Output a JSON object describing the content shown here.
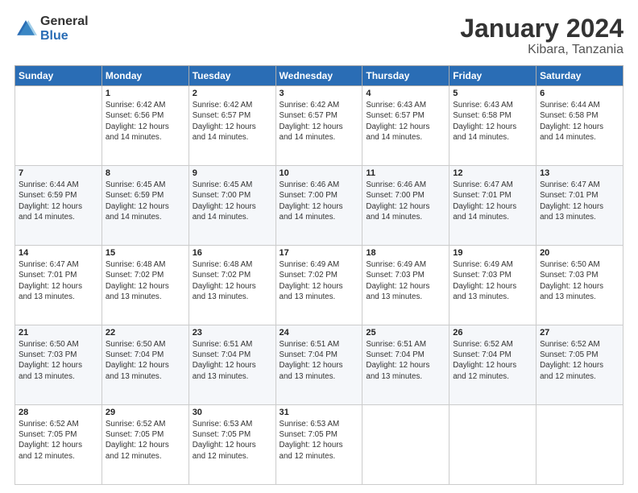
{
  "logo": {
    "general": "General",
    "blue": "Blue"
  },
  "title": {
    "month": "January 2024",
    "location": "Kibara, Tanzania"
  },
  "weekdays": [
    "Sunday",
    "Monday",
    "Tuesday",
    "Wednesday",
    "Thursday",
    "Friday",
    "Saturday"
  ],
  "weeks": [
    [
      {
        "day": "",
        "info": ""
      },
      {
        "day": "1",
        "info": "Sunrise: 6:42 AM\nSunset: 6:56 PM\nDaylight: 12 hours\nand 14 minutes."
      },
      {
        "day": "2",
        "info": "Sunrise: 6:42 AM\nSunset: 6:57 PM\nDaylight: 12 hours\nand 14 minutes."
      },
      {
        "day": "3",
        "info": "Sunrise: 6:42 AM\nSunset: 6:57 PM\nDaylight: 12 hours\nand 14 minutes."
      },
      {
        "day": "4",
        "info": "Sunrise: 6:43 AM\nSunset: 6:57 PM\nDaylight: 12 hours\nand 14 minutes."
      },
      {
        "day": "5",
        "info": "Sunrise: 6:43 AM\nSunset: 6:58 PM\nDaylight: 12 hours\nand 14 minutes."
      },
      {
        "day": "6",
        "info": "Sunrise: 6:44 AM\nSunset: 6:58 PM\nDaylight: 12 hours\nand 14 minutes."
      }
    ],
    [
      {
        "day": "7",
        "info": "Sunrise: 6:44 AM\nSunset: 6:59 PM\nDaylight: 12 hours\nand 14 minutes."
      },
      {
        "day": "8",
        "info": "Sunrise: 6:45 AM\nSunset: 6:59 PM\nDaylight: 12 hours\nand 14 minutes."
      },
      {
        "day": "9",
        "info": "Sunrise: 6:45 AM\nSunset: 7:00 PM\nDaylight: 12 hours\nand 14 minutes."
      },
      {
        "day": "10",
        "info": "Sunrise: 6:46 AM\nSunset: 7:00 PM\nDaylight: 12 hours\nand 14 minutes."
      },
      {
        "day": "11",
        "info": "Sunrise: 6:46 AM\nSunset: 7:00 PM\nDaylight: 12 hours\nand 14 minutes."
      },
      {
        "day": "12",
        "info": "Sunrise: 6:47 AM\nSunset: 7:01 PM\nDaylight: 12 hours\nand 14 minutes."
      },
      {
        "day": "13",
        "info": "Sunrise: 6:47 AM\nSunset: 7:01 PM\nDaylight: 12 hours\nand 13 minutes."
      }
    ],
    [
      {
        "day": "14",
        "info": "Sunrise: 6:47 AM\nSunset: 7:01 PM\nDaylight: 12 hours\nand 13 minutes."
      },
      {
        "day": "15",
        "info": "Sunrise: 6:48 AM\nSunset: 7:02 PM\nDaylight: 12 hours\nand 13 minutes."
      },
      {
        "day": "16",
        "info": "Sunrise: 6:48 AM\nSunset: 7:02 PM\nDaylight: 12 hours\nand 13 minutes."
      },
      {
        "day": "17",
        "info": "Sunrise: 6:49 AM\nSunset: 7:02 PM\nDaylight: 12 hours\nand 13 minutes."
      },
      {
        "day": "18",
        "info": "Sunrise: 6:49 AM\nSunset: 7:03 PM\nDaylight: 12 hours\nand 13 minutes."
      },
      {
        "day": "19",
        "info": "Sunrise: 6:49 AM\nSunset: 7:03 PM\nDaylight: 12 hours\nand 13 minutes."
      },
      {
        "day": "20",
        "info": "Sunrise: 6:50 AM\nSunset: 7:03 PM\nDaylight: 12 hours\nand 13 minutes."
      }
    ],
    [
      {
        "day": "21",
        "info": "Sunrise: 6:50 AM\nSunset: 7:03 PM\nDaylight: 12 hours\nand 13 minutes."
      },
      {
        "day": "22",
        "info": "Sunrise: 6:50 AM\nSunset: 7:04 PM\nDaylight: 12 hours\nand 13 minutes."
      },
      {
        "day": "23",
        "info": "Sunrise: 6:51 AM\nSunset: 7:04 PM\nDaylight: 12 hours\nand 13 minutes."
      },
      {
        "day": "24",
        "info": "Sunrise: 6:51 AM\nSunset: 7:04 PM\nDaylight: 12 hours\nand 13 minutes."
      },
      {
        "day": "25",
        "info": "Sunrise: 6:51 AM\nSunset: 7:04 PM\nDaylight: 12 hours\nand 13 minutes."
      },
      {
        "day": "26",
        "info": "Sunrise: 6:52 AM\nSunset: 7:04 PM\nDaylight: 12 hours\nand 12 minutes."
      },
      {
        "day": "27",
        "info": "Sunrise: 6:52 AM\nSunset: 7:05 PM\nDaylight: 12 hours\nand 12 minutes."
      }
    ],
    [
      {
        "day": "28",
        "info": "Sunrise: 6:52 AM\nSunset: 7:05 PM\nDaylight: 12 hours\nand 12 minutes."
      },
      {
        "day": "29",
        "info": "Sunrise: 6:52 AM\nSunset: 7:05 PM\nDaylight: 12 hours\nand 12 minutes."
      },
      {
        "day": "30",
        "info": "Sunrise: 6:53 AM\nSunset: 7:05 PM\nDaylight: 12 hours\nand 12 minutes."
      },
      {
        "day": "31",
        "info": "Sunrise: 6:53 AM\nSunset: 7:05 PM\nDaylight: 12 hours\nand 12 minutes."
      },
      {
        "day": "",
        "info": ""
      },
      {
        "day": "",
        "info": ""
      },
      {
        "day": "",
        "info": ""
      }
    ]
  ]
}
